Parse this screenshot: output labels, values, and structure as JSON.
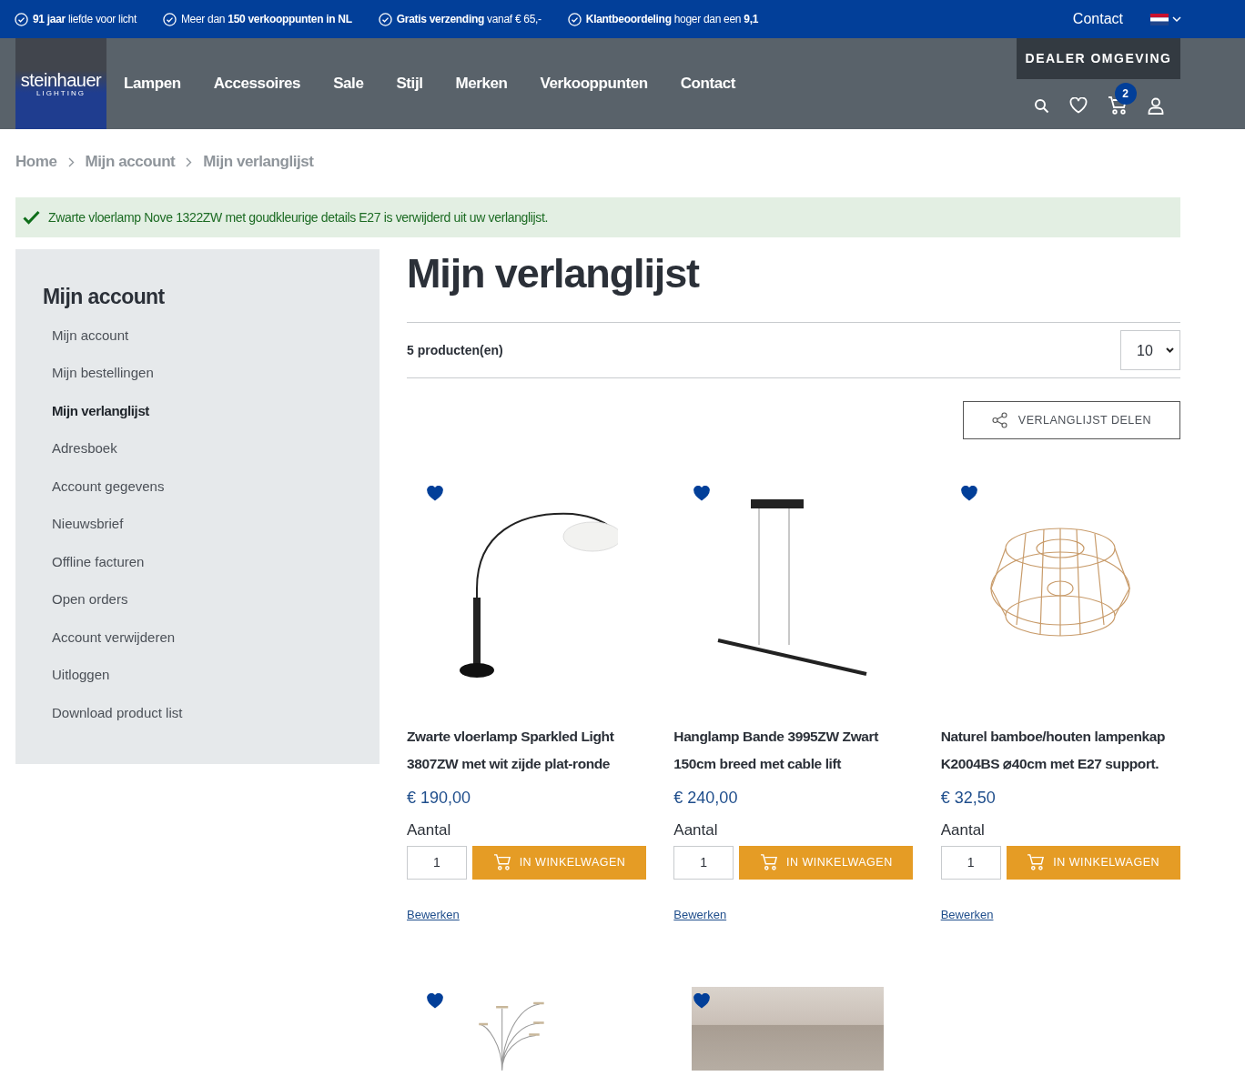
{
  "top_bar": {
    "usps": [
      "**91 jaar** liefde voor licht",
      "Meer dan **150 verkooppunten in NL**",
      "**Gratis verzending** vanaf € 65,-",
      "**Klantbeoordeling** hoger dan een **9,1**"
    ],
    "contact": "Contact"
  },
  "header": {
    "logo": "steinhauer",
    "logo_tagline": "LIGHTING",
    "nav": [
      "Lampen",
      "Accessoires",
      "Sale",
      "Stijl",
      "Merken",
      "Verkooppunten",
      "Contact"
    ],
    "dealer_button": "DEALER OMGEVING",
    "cart_count": "2"
  },
  "breadcrumb": [
    "Home",
    "Mijn account",
    "Mijn verlanglijst"
  ],
  "alert": "Zwarte vloerlamp Nove 1322ZW met goudkleurige details E27 is verwijderd uit uw verlanglijst.",
  "sidebar": {
    "title": "Mijn account",
    "items": [
      {
        "label": "Mijn account",
        "selected": false
      },
      {
        "label": "Mijn bestellingen",
        "selected": false
      },
      {
        "label": "Mijn verlanglijst",
        "selected": true
      },
      {
        "label": "Adresboek",
        "selected": false
      },
      {
        "label": "Account gegevens",
        "selected": false
      },
      {
        "label": "Nieuwsbrief",
        "selected": false
      },
      {
        "label": "Offline facturen",
        "selected": false
      },
      {
        "label": "Open orders",
        "selected": false
      },
      {
        "label": "Account verwijderen",
        "selected": false
      },
      {
        "label": "Uitloggen",
        "selected": false
      },
      {
        "label": "Download product list",
        "selected": false
      }
    ]
  },
  "main": {
    "title": "Mijn verlanglijst",
    "count": "5 producten(en)",
    "per_page": "10",
    "share_button": "VERLANGLIJST DELEN",
    "products": [
      {
        "kind": "arc_lamp",
        "favorite": true,
        "title": "Zwarte vloerlamp Sparkled Light 3807ZW met wit zijde plat-ronde",
        "price": "€ 190,00",
        "quantity_label": "Aantal",
        "quantity": "1",
        "add_button": "IN WINKELWAGEN",
        "edit_link": "Bewerken"
      },
      {
        "kind": "pendant",
        "favorite": true,
        "title": "Hanglamp Bande 3995ZW Zwart 150cm breed met cable lift",
        "price": "€ 240,00",
        "quantity_label": "Aantal",
        "quantity": "1",
        "add_button": "IN WINKELWAGEN",
        "edit_link": "Bewerken"
      },
      {
        "kind": "bamboo_shade",
        "favorite": true,
        "title": "Naturel bamboe/houten lampenkap K2004BS ⌀40cm met E27 support.",
        "price": "€ 32,50",
        "quantity_label": "Aantal",
        "quantity": "1",
        "add_button": "IN WINKELWAGEN",
        "edit_link": "Bewerken"
      },
      {
        "kind": "multi_arm_lamp",
        "favorite": true
      },
      {
        "kind": "photo",
        "favorite": true
      }
    ]
  }
}
